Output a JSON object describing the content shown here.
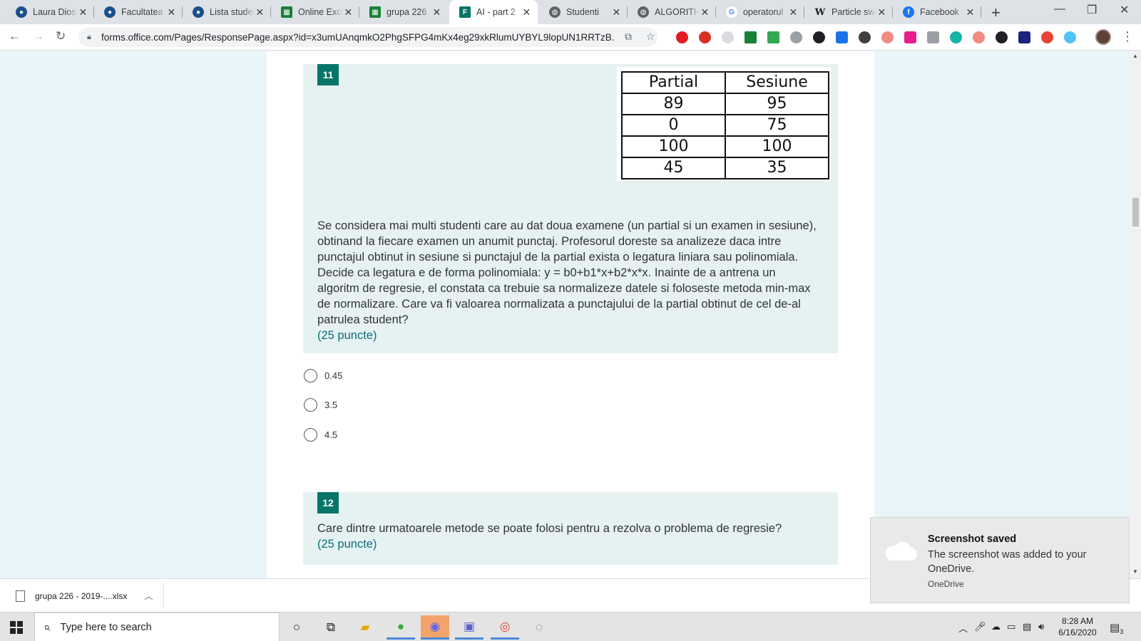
{
  "browser": {
    "tabs": [
      {
        "title": "Laura Dioșan",
        "icon": "moodle-icon",
        "color": "#1a4f8b"
      },
      {
        "title": "Facultatea de",
        "icon": "moodle-icon",
        "color": "#1a4f8b"
      },
      {
        "title": "Lista studenti",
        "icon": "moodle-icon",
        "color": "#1a4f8b"
      },
      {
        "title": "Online Excel",
        "icon": "sheets-icon",
        "color": "#188038"
      },
      {
        "title": "grupa 226",
        "icon": "sheets-icon",
        "color": "#188038"
      },
      {
        "title": "AI - part 2",
        "icon": "forms-icon",
        "color": "#077568",
        "active": true
      },
      {
        "title": "Studenti",
        "icon": "globe-icon",
        "color": "#5f6368"
      },
      {
        "title": "ALGORITHM",
        "icon": "globe-icon",
        "color": "#5f6368"
      },
      {
        "title": "operatorul",
        "icon": "google-icon",
        "color": "#4285f4"
      },
      {
        "title": "Particle swarm",
        "icon": "wikipedia-icon",
        "color": "#202124"
      },
      {
        "title": "Facebook",
        "icon": "facebook-icon",
        "color": "#1877f2"
      }
    ],
    "url": "forms.office.com/Pages/ResponsePage.aspx?id=x3umUAnqmkO2PhgSFPG4mKx4eg29xkRlumUYBYL9lopUN1RRTzB..."
  },
  "questions": [
    {
      "number": "11",
      "table": {
        "headers": [
          "Partial",
          "Sesiune"
        ],
        "rows": [
          [
            "89",
            "95"
          ],
          [
            "0",
            "75"
          ],
          [
            "100",
            "100"
          ],
          [
            "45",
            "35"
          ]
        ]
      },
      "lines": [
        "Se considera mai multi studenti care au dat doua examene (un partial si un examen in sesiune),",
        "obtinand la fiecare examen un anumit punctaj. Profesorul doreste sa analizeze daca intre",
        "punctajul obtinut in sesiune si punctajul de la partial exista o legatura liniara sau polinomiala.",
        "Decide ca legatura e de forma polinomiala: y = b0+b1*x+b2*x*x. Inainte de a antrena un",
        "algoritm de regresie, el constata ca trebuie sa normalizeze datele si foloseste metoda min-max",
        "de normalizare. Care va fi valoarea normalizata a punctajului de la partial obtinut de cel de-al",
        "patrulea student?"
      ],
      "points": "(25 puncte)",
      "options": [
        "0.45",
        "3.5",
        "4.5"
      ]
    },
    {
      "number": "12",
      "lines": [
        "Care dintre urmatoarele metode se poate folosi pentru a rezolva  o problema de regresie?"
      ],
      "points": "(25 puncte)"
    }
  ],
  "download": {
    "filename": "grupa 226 - 2019-....xlsx"
  },
  "toast": {
    "title": "Screenshot saved",
    "message": "The screenshot was added to your OneDrive.",
    "source": "OneDrive"
  },
  "taskbar": {
    "search_placeholder": "Type here to search",
    "time": "8:28 AM",
    "date": "6/16/2020",
    "notification_count": "3"
  }
}
